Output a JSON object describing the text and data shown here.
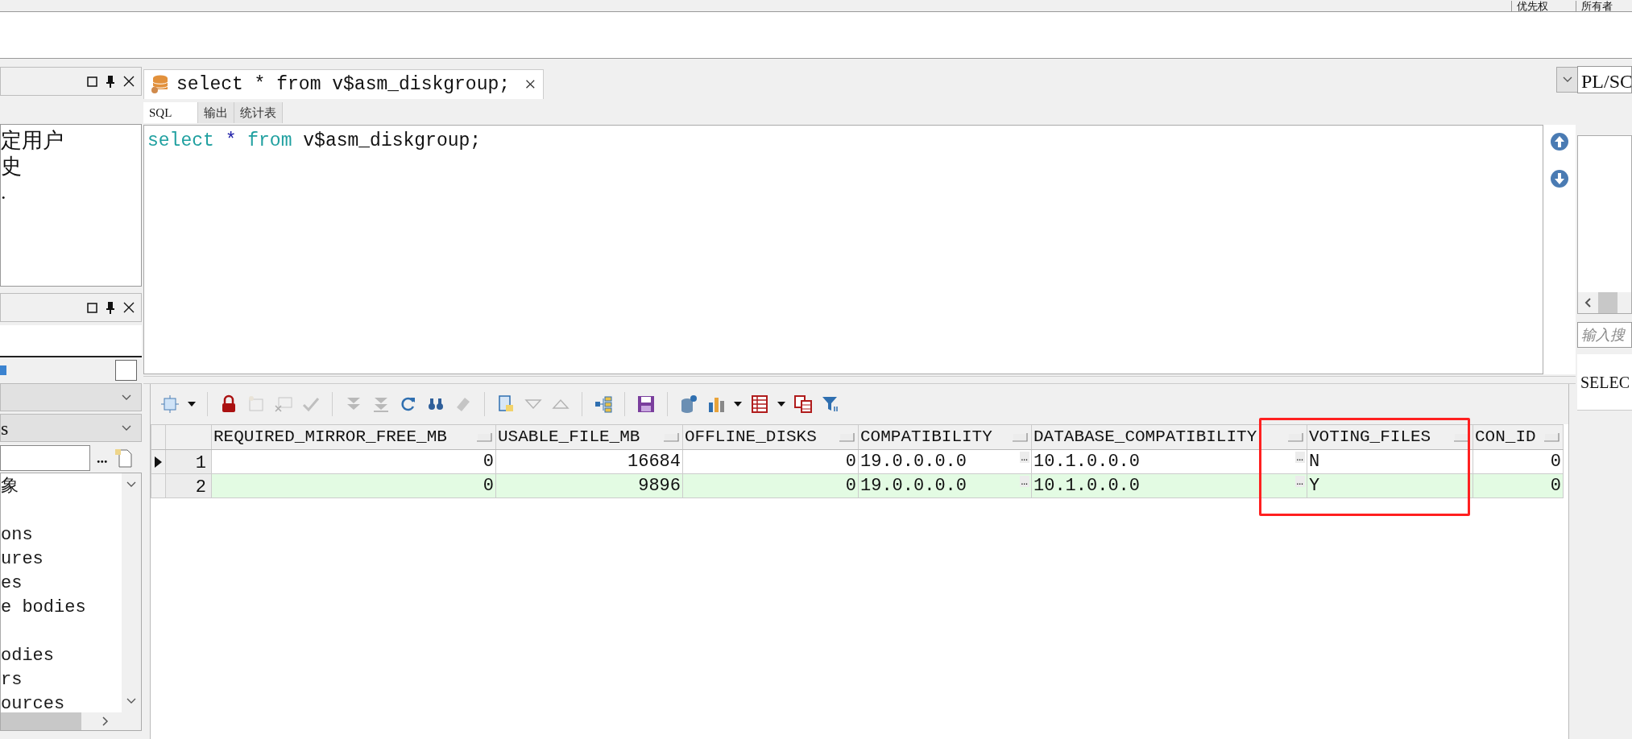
{
  "top_strip": {
    "column_headers": [
      "优先权",
      "所有者"
    ]
  },
  "left_panel": {
    "upper_items": [
      "定用户",
      "史",
      "."
    ],
    "filter_checked": false,
    "filter_value": "s",
    "more_button": "...",
    "tree_groups": [
      {
        "items": [
          "象"
        ]
      },
      {
        "items": [
          "ons",
          "ures",
          "es",
          "e bodies"
        ]
      },
      {
        "items": [
          "odies",
          "rs",
          "ources"
        ]
      }
    ]
  },
  "editor": {
    "tabs": [
      {
        "title": "select * from v$asm_diskgroup;",
        "selected": true,
        "close": "×"
      }
    ],
    "subtabs": [
      {
        "label": "SQL",
        "selected": true
      },
      {
        "label": "输出",
        "selected": false
      },
      {
        "label": "统计表",
        "selected": false
      }
    ],
    "code_tokens": [
      {
        "text": "select",
        "kind": "keyword"
      },
      {
        "text": "*",
        "kind": "operator"
      },
      {
        "text": "from",
        "kind": "keyword"
      },
      {
        "text": "v$asm_diskgroup;",
        "kind": "plain"
      }
    ]
  },
  "grid": {
    "columns": [
      {
        "name": "REQUIRED_MIRROR_FREE_MB",
        "kind": "number"
      },
      {
        "name": "USABLE_FILE_MB",
        "kind": "number"
      },
      {
        "name": "OFFLINE_DISKS",
        "kind": "number"
      },
      {
        "name": "COMPATIBILITY",
        "kind": "text"
      },
      {
        "name": "DATABASE_COMPATIBILITY",
        "kind": "text"
      },
      {
        "name": "VOTING_FILES",
        "kind": "text"
      },
      {
        "name": "CON_ID",
        "kind": "number"
      }
    ],
    "rows": [
      {
        "row_number": "1",
        "current": true,
        "shaded": false,
        "cells": [
          {
            "value": "0"
          },
          {
            "value": "16684"
          },
          {
            "value": "0"
          },
          {
            "value": "19.0.0.0.0",
            "button": "…"
          },
          {
            "value": "10.1.0.0.0",
            "button": "…"
          },
          {
            "value": "N"
          },
          {
            "value": "0"
          }
        ]
      },
      {
        "row_number": "2",
        "current": false,
        "shaded": true,
        "cells": [
          {
            "value": "0"
          },
          {
            "value": "9896"
          },
          {
            "value": "0"
          },
          {
            "value": "19.0.0.0.0",
            "button": "…"
          },
          {
            "value": "10.1.0.0.0",
            "button": "…"
          },
          {
            "value": "Y"
          },
          {
            "value": "0"
          }
        ]
      }
    ]
  },
  "right_panel": {
    "dropdown_value": "PL/SC",
    "search_placeholder": "输入搜",
    "list_items": [
      "SELEC"
    ]
  }
}
